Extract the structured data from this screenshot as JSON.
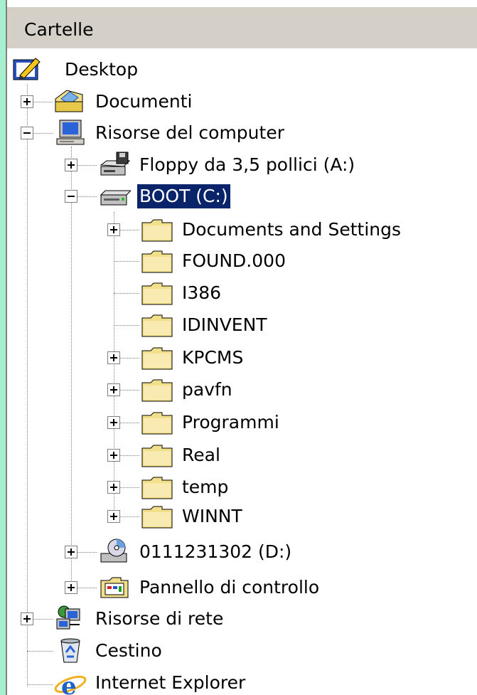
{
  "header": {
    "title": "Cartelle"
  },
  "tree": {
    "desktop": "Desktop",
    "documenti": "Documenti",
    "risorse_computer": "Risorse del computer",
    "floppy": "Floppy da 3,5 pollici (A:)",
    "boot": "BOOT (C:)",
    "c_folders": [
      "Documents and Settings",
      "FOUND.000",
      "I386",
      "IDINVENT",
      "KPCMS",
      "pavfn",
      "Programmi",
      "Real",
      "temp",
      "WINNT"
    ],
    "cd_drive": "0111231302 (D:)",
    "pannello": "Pannello di controllo",
    "risorse_rete": "Risorse di rete",
    "cestino": "Cestino",
    "ie": "Internet Explorer"
  },
  "selected_item": "BOOT (C:)",
  "colors": {
    "selection": "#0a246a",
    "folder": "#f2df8a",
    "background": "#a7f0cf",
    "header": "#d4d0c8"
  }
}
